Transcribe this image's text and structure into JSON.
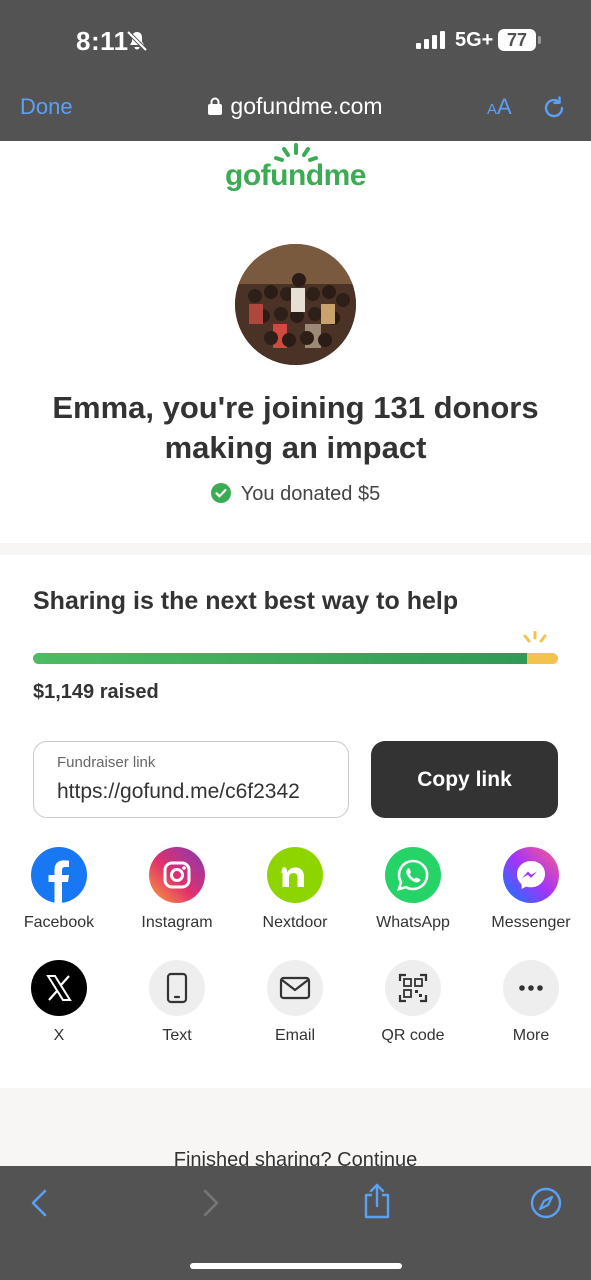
{
  "status_bar": {
    "time": "8:11",
    "network": "5G+",
    "battery": "77"
  },
  "safari": {
    "done_label": "Done",
    "url": "gofundme.com",
    "text_size_label_small": "A",
    "text_size_label_large": "A"
  },
  "page": {
    "logo_text": "gofundme",
    "headline_line1": "Emma, you're joining 131 donors",
    "headline_line2": "making an impact",
    "donated_text": "You donated $5",
    "share_title": "Sharing is the next best way to help",
    "progress": 0.94,
    "raised_text": "$1,149 raised",
    "link_label": "Fundraiser link",
    "link_value": "https://gofund.me/c6f2342",
    "copy_label": "Copy link",
    "share_items": [
      {
        "label": "Facebook",
        "icon": "facebook-icon",
        "color": "#1877f2"
      },
      {
        "label": "Instagram",
        "icon": "instagram-icon",
        "color": "#e1306c"
      },
      {
        "label": "Nextdoor",
        "icon": "nextdoor-icon",
        "color": "#8ed500"
      },
      {
        "label": "WhatsApp",
        "icon": "whatsapp-icon",
        "color": "#25d366"
      },
      {
        "label": "Messenger",
        "icon": "messenger-icon",
        "color": "#a334fa"
      },
      {
        "label": "X",
        "icon": "x-icon",
        "color": "#000000"
      },
      {
        "label": "Text",
        "icon": "phone-icon",
        "color": "#eeeeee"
      },
      {
        "label": "Email",
        "icon": "mail-icon",
        "color": "#eeeeee"
      },
      {
        "label": "QR code",
        "icon": "qr-code-icon",
        "color": "#eeeeee"
      },
      {
        "label": "More",
        "icon": "more-icon",
        "color": "#eeeeee"
      }
    ],
    "finished_text": "Finished sharing? Continue"
  },
  "colors": {
    "brand_green": "#3bab54",
    "chrome_gray": "#535353",
    "link_blue": "#5aa0f5",
    "progress_yellow": "#f2c34d"
  }
}
